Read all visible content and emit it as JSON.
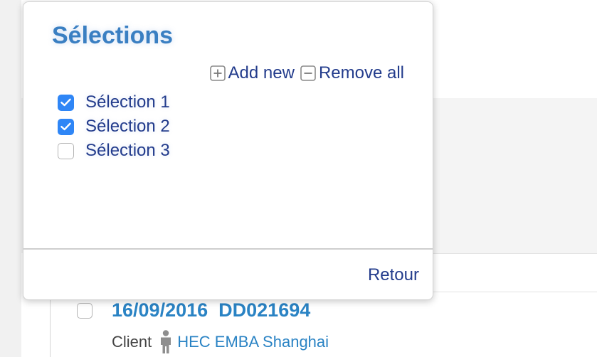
{
  "popover": {
    "title": "Sélections",
    "actions": {
      "add_new": "Add new",
      "add_icon": "plus-square-icon",
      "remove_all": "Remove all",
      "remove_icon": "minus-square-icon"
    },
    "selections": [
      {
        "label": "Sélection 1",
        "checked": true
      },
      {
        "label": "Sélection 2",
        "checked": true
      },
      {
        "label": "Sélection 3",
        "checked": false
      }
    ],
    "back_label": "Retour"
  },
  "background_row": {
    "date": "16/09/2016",
    "reference": "DD021694",
    "client_label": "Client",
    "client_icon": "person-icon",
    "client_name": "HEC EMBA Shanghai",
    "checked": false
  },
  "colors": {
    "title_blue": "#3a7fc2",
    "link_navy": "#233c8c",
    "checkbox_blue": "#2f86f6",
    "row_title_blue": "#2a83c4"
  }
}
